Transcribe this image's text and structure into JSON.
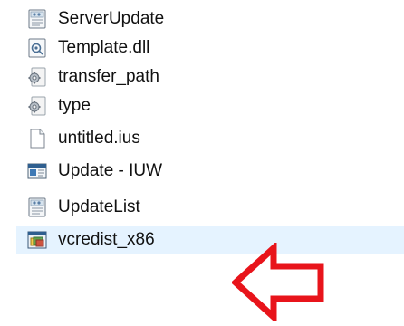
{
  "files": [
    {
      "name": "ServerUpdate",
      "icon": "config-file-icon"
    },
    {
      "name": "Template.dll",
      "icon": "dll-file-icon"
    },
    {
      "name": "transfer_path",
      "icon": "system-file-icon"
    },
    {
      "name": "type",
      "icon": "system-file-icon"
    },
    {
      "name": "untitled.ius",
      "icon": "blank-file-icon"
    },
    {
      "name": "Update - IUW",
      "icon": "application-window-icon"
    },
    {
      "name": "UpdateList",
      "icon": "config-file-icon"
    },
    {
      "name": "vcredist_x86",
      "icon": "installer-icon"
    }
  ],
  "annotation": {
    "arrow_color": "#e8141b"
  }
}
